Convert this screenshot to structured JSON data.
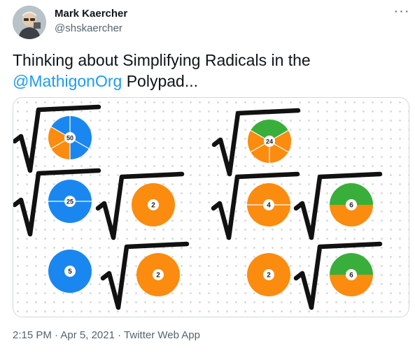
{
  "author": {
    "name": "Mark Kaercher",
    "handle": "@shskaercher"
  },
  "more_icon": "more-horizontal-icon",
  "tweet": {
    "text_before": "Thinking about Simplifying Radicals in the",
    "mention": "@MathigonOrg",
    "text_after": " Polypad..."
  },
  "polypad": {
    "colors": {
      "blue": "#1a87f0",
      "orange": "#fb8c0f",
      "green": "#3aae3a",
      "radical": "#111111"
    },
    "discs": [
      {
        "label": "50",
        "has_radical": true,
        "fill": "split-blue-orange"
      },
      {
        "label": "24",
        "has_radical": true,
        "fill": "split-green-orange"
      },
      {
        "label": "25",
        "has_radical": true,
        "fill": "blue"
      },
      {
        "label": "2",
        "has_radical": true,
        "fill": "orange"
      },
      {
        "label": "4",
        "has_radical": true,
        "fill": "orange"
      },
      {
        "label": "6",
        "has_radical": true,
        "fill": "half-green-orange"
      },
      {
        "label": "5",
        "has_radical": false,
        "fill": "blue"
      },
      {
        "label": "2",
        "has_radical": true,
        "fill": "orange"
      },
      {
        "label": "2",
        "has_radical": false,
        "fill": "orange"
      },
      {
        "label": "6",
        "has_radical": true,
        "fill": "half-green-orange"
      }
    ]
  },
  "meta": {
    "time": "2:15 PM",
    "date": "Apr 5, 2021",
    "source": "Twitter Web App"
  }
}
